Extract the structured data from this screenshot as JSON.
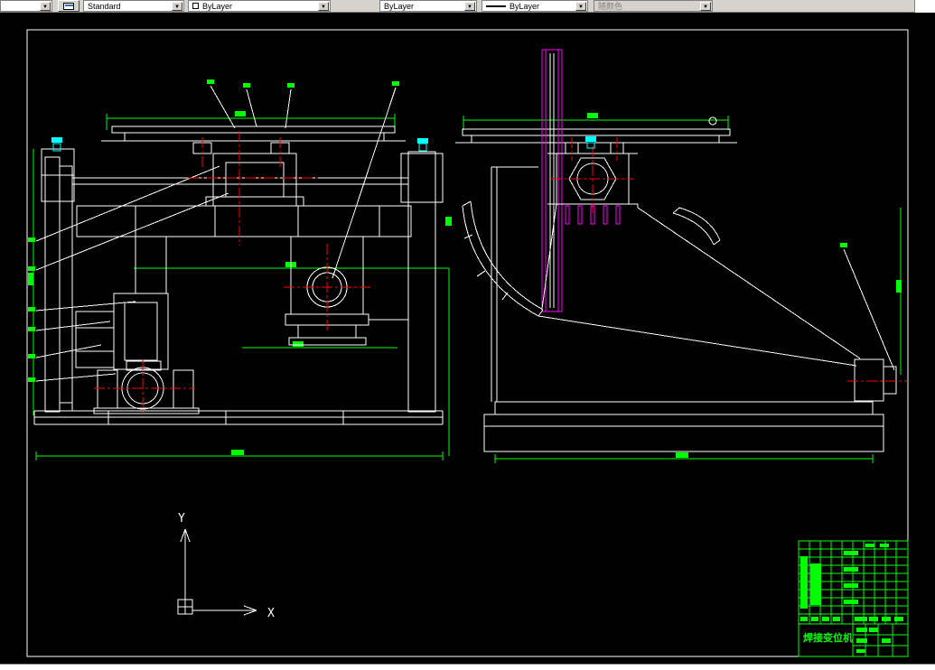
{
  "toolbar": {
    "dropdown_arrow": "▼",
    "style_label": "Standard",
    "color_label": "ByLayer",
    "linetype_label": "ByLayer",
    "lineweight_label": "ByLayer",
    "plotstyle_label": "随颜色"
  },
  "canvas": {
    "ucs": {
      "x_label": "X",
      "y_label": "Y"
    },
    "title_block": {
      "title": "焊接变位机"
    },
    "colors": {
      "background": "#000000",
      "geometry": "#FFFFFF",
      "dimensions": "#00FF00",
      "centerlines": "#FF0000",
      "disc_edges": "#FF00FF",
      "fasteners": "#00FFFF",
      "toolbar_face": "#D6D3CE"
    }
  }
}
